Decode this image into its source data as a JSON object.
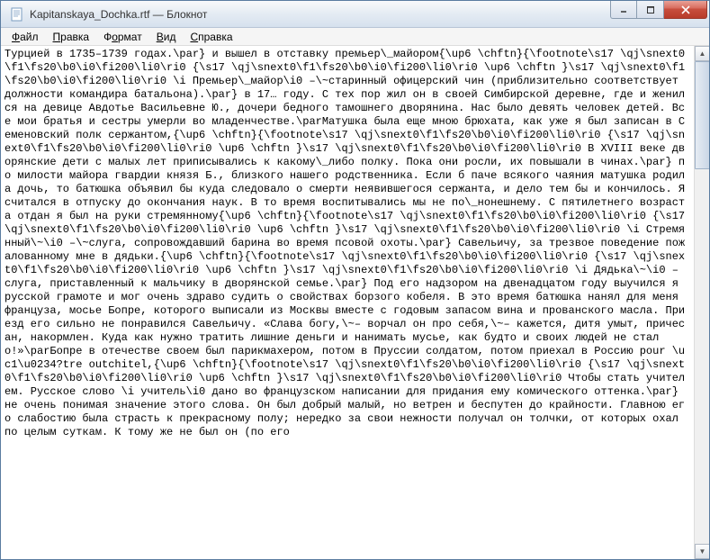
{
  "titlebar": {
    "title": "Kapitanskaya_Dochka.rtf — Блокнот",
    "icon": "notepad-icon"
  },
  "window_controls": {
    "minimize": "minimize",
    "maximize": "maximize",
    "close": "close"
  },
  "menubar": {
    "file": {
      "key": "Ф",
      "rest": "айл"
    },
    "edit": {
      "key": "П",
      "rest": "равка"
    },
    "format": {
      "key": "о",
      "pre": "Ф",
      "rest": "рмат"
    },
    "view": {
      "key": "В",
      "rest": "ид"
    },
    "help": {
      "key": "С",
      "rest": "правка"
    }
  },
  "document": {
    "text": "Турцией в 1735–1739 годах.\\par} и вышел в отставку премьер\\_майором{\\up6 \\chftn}{\\footnote\\s17 \\qj\\snext0\\f1\\fs20\\b0\\i0\\fi200\\li0\\ri0 {\\s17 \\qj\\snext0\\f1\\fs20\\b0\\i0\\fi200\\li0\\ri0 \\up6 \\chftn }\\s17 \\qj\\snext0\\f1\\fs20\\b0\\i0\\fi200\\li0\\ri0 \\i Премьер\\_майор\\i0 –\\~старинный офицерский чин (приблизительно соответствует должности командира батальона).\\par} в 17… году. С тех пор жил он в своей Симбирской деревне, где и женился на девице Авдотье Васильевне Ю., дочери бедного тамошнего дворянина. Нас было девять человек детей. Все мои братья и сестры умерли во младенчестве.\\parМатушка была еще мною брюхата, как уже я был записан в Семеновский полк сержантом,{\\up6 \\chftn}{\\footnote\\s17 \\qj\\snext0\\f1\\fs20\\b0\\i0\\fi200\\li0\\ri0 {\\s17 \\qj\\snext0\\f1\\fs20\\b0\\i0\\fi200\\li0\\ri0 \\up6 \\chftn }\\s17 \\qj\\snext0\\f1\\fs20\\b0\\i0\\fi200\\li0\\ri0 В XVIII веке дворянские дети с малых лет приписывались к какому\\_либо полку. Пока они росли, их повышали в чинах.\\par} по милости майора гвардии князя Б., близкого нашего родственника. Если б паче всякого чаяния матушка родила дочь, то батюшка объявил бы куда следовало о смерти неявившегося сержанта, и дело тем бы и кончилось. Я считался в отпуску до окончания наук. В то время воспитывались мы не по\\_нонешнему. С пятилетнего возраста отдан я был на руки стремянному{\\up6 \\chftn}{\\footnote\\s17 \\qj\\snext0\\f1\\fs20\\b0\\i0\\fi200\\li0\\ri0 {\\s17 \\qj\\snext0\\f1\\fs20\\b0\\i0\\fi200\\li0\\ri0 \\up6 \\chftn }\\s17 \\qj\\snext0\\f1\\fs20\\b0\\i0\\fi200\\li0\\ri0 \\i Стремянный\\~\\i0 –\\~слуга, сопровождавший барина во время псовой охоты.\\par} Савельичу, за трезвое поведение пожалованному мне в дядьки.{\\up6 \\chftn}{\\footnote\\s17 \\qj\\snext0\\f1\\fs20\\b0\\i0\\fi200\\li0\\ri0 {\\s17 \\qj\\snext0\\f1\\fs20\\b0\\i0\\fi200\\li0\\ri0 \\up6 \\chftn }\\s17 \\qj\\snext0\\f1\\fs20\\b0\\i0\\fi200\\li0\\ri0 \\i Дядька\\~\\i0 – слуга, приставленный к мальчику в дворянской семье.\\par} Под его надзором на двенадцатом году выучился я русской грамоте и мог очень здраво судить о свойствах борзого кобеля. В это время батюшка нанял для меня француза, мосье Бопре, которого выписали из Москвы вместе с годовым запасом вина и прованского масла. Приезд его сильно не понравился Савельичу. «Слава богу,\\~– ворчал он про себя,\\~– кажется, дитя умыт, причесан, накормлен. Куда как нужно тратить лишние деньги и нанимать мусье, как будто и своих людей не стало!»\\parБопре в отечестве своем был парикмахером, потом в Пруссии солдатом, потом приехал в Россию pour \\uc1\\u0234?tre outchitel,{\\up6 \\chftn}{\\footnote\\s17 \\qj\\snext0\\f1\\fs20\\b0\\i0\\fi200\\li0\\ri0 {\\s17 \\qj\\snext0\\f1\\fs20\\b0\\i0\\fi200\\li0\\ri0 \\up6 \\chftn }\\s17 \\qj\\snext0\\f1\\fs20\\b0\\i0\\fi200\\li0\\ri0 Чтобы стать учителем. Русское слово \\i учитель\\i0 дано во французском написании для придания ему комического оттенка.\\par} не очень понимая значение этого слова. Он был добрый малый, но ветрен и беспутен до крайности. Главною его слабостию была страсть к прекрасному полу; нередко за свои нежности получал он толчки, от которых охал по целым суткам. К тому же не был он (по его"
  }
}
